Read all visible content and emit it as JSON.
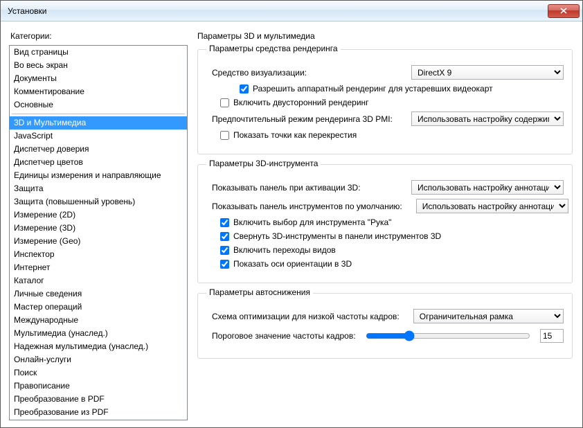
{
  "window": {
    "title": "Установки"
  },
  "categories": {
    "label": "Категории:",
    "group1": [
      "Вид страницы",
      "Во весь экран",
      "Документы",
      "Комментирование",
      "Основные"
    ],
    "group2": [
      "3D и Мультимедиа",
      "JavaScript",
      "Диспетчер доверия",
      "Диспетчер цветов",
      "Единицы измерения и направляющие",
      "Защита",
      "Защита (повышенный уровень)",
      "Измерение (2D)",
      "Измерение (3D)",
      "Измерение (Geo)",
      "Инспектор",
      "Интернет",
      "Каталог",
      "Личные сведения",
      "Мастер операций",
      "Международные",
      "Мультимедиа (унаслед.)",
      "Надежная мультимедиа (унаслед.)",
      "Онлайн-услуги",
      "Поиск",
      "Правописание",
      "Преобразование в PDF",
      "Преобразование из PDF"
    ],
    "selected": "3D и Мультимедиа"
  },
  "page": {
    "title": "Параметры 3D и мультимедиа",
    "rendering": {
      "group_title": "Параметры средства рендеринга",
      "viz_label": "Средство визуализации:",
      "viz_value": "DirectX 9",
      "hw_legacy_label": "Разрешить аппаратный рендеринг для устаревших видеокарт",
      "hw_legacy_checked": true,
      "double_sided_label": "Включить двусторонний рендеринг",
      "double_sided_checked": false,
      "pmi_label": "Предпочтительный режим рендеринга 3D PMI:",
      "pmi_value": "Использовать настройку содержимого",
      "crosshair_label": "Показать точки как перекрестия",
      "crosshair_checked": false
    },
    "tool": {
      "group_title": "Параметры 3D-инструмента",
      "panel_on_activate_label": "Показывать панель при активации 3D:",
      "panel_on_activate_value": "Использовать настройку аннотаций",
      "default_toolbar_label": "Показывать панель инструментов по умолчанию:",
      "default_toolbar_value": "Использовать настройку аннотаций",
      "hand_select_label": "Включить выбор для инструмента \"Рука\"",
      "hand_select_checked": true,
      "collapse_label": "Свернуть 3D-инструменты в панели инструментов 3D",
      "collapse_checked": true,
      "transitions_label": "Включить переходы видов",
      "transitions_checked": true,
      "axes_label": "Показать оси ориентации в 3D",
      "axes_checked": true
    },
    "autodegrade": {
      "group_title": "Параметры автоснижения",
      "scheme_label": "Схема оптимизации для низкой частоты кадров:",
      "scheme_value": "Ограничительная рамка",
      "threshold_label": "Пороговое значение частоты кадров:",
      "threshold_value": "15"
    }
  }
}
